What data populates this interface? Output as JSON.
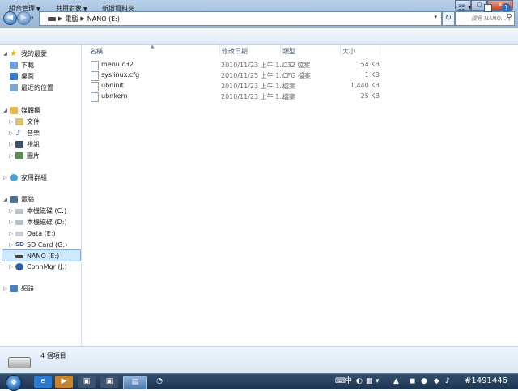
{
  "address": {
    "crumbs": [
      "電腦",
      "NANO (E:)"
    ],
    "search_placeholder": "搜尋 NANO..."
  },
  "window_controls": {
    "minimize": "—",
    "maximize": "▢",
    "close": "✕"
  },
  "toolbar": {
    "organize": "組合管理",
    "share": "共用對象",
    "new_folder": "新增資料夾"
  },
  "nav": {
    "favorites": "我的最愛",
    "downloads": "下載",
    "desktop": "桌面",
    "recent": "最近的位置",
    "libraries": "媒體櫃",
    "documents": "文件",
    "music": "音樂",
    "videos": "視訊",
    "pictures": "圖片",
    "homegroup": "家用群組",
    "computer": "電腦",
    "drive_c": "本機磁碟 (C:)",
    "drive_d": "本機磁碟 (D:)",
    "drive_e": "Data (E:)",
    "drive_g": "SD Card (G:)",
    "drive_nano": "NANO (E:)",
    "drive_j": "ConnMgr (J:)",
    "network": "網路"
  },
  "columns": {
    "name": "名稱",
    "date": "修改日期",
    "type": "類型",
    "size": "大小"
  },
  "files": [
    {
      "name": "menu.c32",
      "date": "2010/11/23 上午 1...",
      "type": "C32 檔案",
      "size": "54 KB"
    },
    {
      "name": "syslinux.cfg",
      "date": "2010/11/23 上午 1...",
      "type": "CFG 檔案",
      "size": "1 KB"
    },
    {
      "name": "ubninit",
      "date": "2010/11/23 上午 1...",
      "type": "檔案",
      "size": "1,440 KB"
    },
    {
      "name": "ubnkern",
      "date": "2010/11/23 上午 1...",
      "type": "檔案",
      "size": "25 KB"
    }
  ],
  "status": {
    "item_count": "4 個項目"
  },
  "taskbar": {
    "ime": "中",
    "watermark": "#1491446"
  },
  "colors": {
    "selection": "#cde8ff",
    "titlebar": "#a7c2df",
    "taskbar": "#1d3450"
  }
}
